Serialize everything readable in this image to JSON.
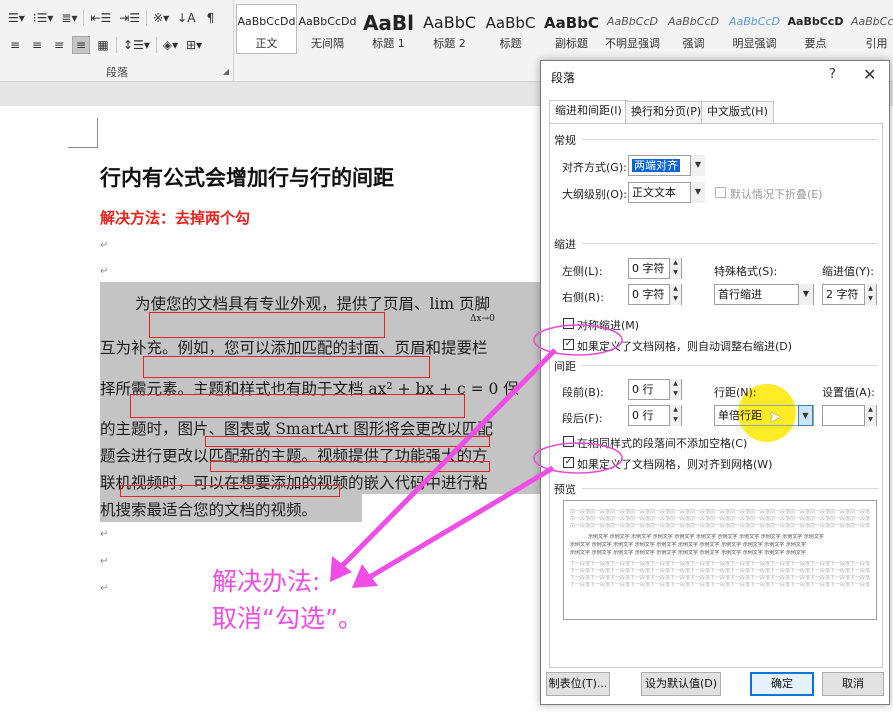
{
  "ribbon": {
    "paragraph_group_label": "段落",
    "styles": [
      {
        "sample": "AaBbCcDd",
        "name": "正文",
        "selected": true
      },
      {
        "sample": "AaBbCcDd",
        "name": "无间隔"
      },
      {
        "sample": "AaBl",
        "name": "标题 1"
      },
      {
        "sample": "AaBbC",
        "name": "标题 2"
      },
      {
        "sample": "AaBbC",
        "name": "标题"
      },
      {
        "sample": "AaBbC",
        "name": "副标题"
      },
      {
        "sample": "AaBbCcD",
        "name": "不明显强调"
      },
      {
        "sample": "AaBbCcD",
        "name": "强调"
      },
      {
        "sample": "AaBbCcD",
        "name": "明显强调"
      },
      {
        "sample": "AaBbCcD",
        "name": "要点"
      },
      {
        "sample": "AaBbCcD",
        "name": "引用"
      }
    ]
  },
  "document": {
    "title": "行内有公式会增加行与行的间距",
    "subtitle": "解决方法：去掉两个勾",
    "body_lines": [
      "为使您的文档具有专业外观，提供了页眉、lim 页脚",
      "互为补充。例如，您可以添加匹配的封面、页眉和提要栏",
      "择所需元素。主题和样式也有助于文档 ax² + bx + c = 0 保",
      "的主题时，图片、图表或 SmartArt 图形将会更改以匹配",
      "题会进行更改以匹配新的主题。视频提供了功能强大的方",
      "联机视频时，可以在想要添加的视频的嵌入代码中进行粘",
      "机搜索最适合您的文档的视频。"
    ],
    "formula_sub": "Δx→0",
    "annotation": [
      "解决办法:",
      "取消“勾选”。"
    ]
  },
  "dialog": {
    "title": "段落",
    "help": "?",
    "close": "✕",
    "tabs": [
      "缩进和间距(I)",
      "换行和分页(P)",
      "中文版式(H)"
    ],
    "general": {
      "section": "常规",
      "alignment_label": "对齐方式(G):",
      "alignment_value": "两端对齐",
      "outline_label": "大纲级别(O):",
      "outline_value": "正文文本",
      "collapse_label": "默认情况下折叠(E)"
    },
    "indent": {
      "section": "缩进",
      "left_label": "左侧(L):",
      "left_value": "0 字符",
      "right_label": "右侧(R):",
      "right_value": "0 字符",
      "special_label": "特殊格式(S):",
      "special_value": "首行缩进",
      "by_label": "缩进值(Y):",
      "by_value": "2 字符",
      "mirror_label": "对称缩进(M)",
      "auto_adjust_label": "如果定义了文档网格，则自动调整右缩进(D)"
    },
    "spacing": {
      "section": "间距",
      "before_label": "段前(B):",
      "before_value": "0 行",
      "after_label": "段后(F):",
      "after_value": "0 行",
      "line_label": "行距(N):",
      "line_value": "单倍行距",
      "at_label": "设置值(A):",
      "at_value": "",
      "no_space_label": "在相同样式的段落间不添加空格(C)",
      "snap_grid_label": "如果定义了文档网格，则对齐到网格(W)"
    },
    "preview": {
      "section": "预览",
      "prev_text": "前一段落前一段落前一段落前一段落前一段落前一段落前一段落前一段落前一段落前一段落前一段落前一段落前一段落前一段落前一段落前一段落",
      "sample_text": "示例文字 示例文字 示例文字 示例文字 示例文字 示例文字 示例文字 示例文字 示例文字 示例文字 示例文字",
      "next_text": "下一段落下一段落下一段落下一段落下一段落下一段落下一段落下一段落下一段落下一段落下一段落下一段落下一段落下一段落下一段落"
    },
    "buttons": {
      "tabs": "制表位(T)...",
      "set_default": "设为默认值(D)",
      "ok": "确定",
      "cancel": "取消"
    },
    "check_mark": "✓"
  }
}
